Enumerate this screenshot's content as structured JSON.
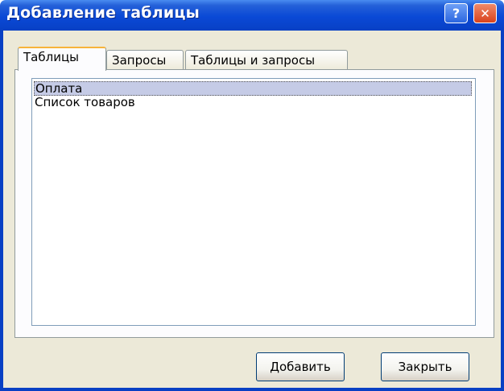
{
  "window": {
    "title": "Добавление таблицы",
    "help_label": "?",
    "close_label": "✕"
  },
  "tabs": [
    {
      "label": "Таблицы",
      "active": true
    },
    {
      "label": "Запросы",
      "active": false
    },
    {
      "label": "Таблицы и запросы",
      "active": false
    }
  ],
  "list": {
    "items": [
      {
        "label": "Оплата",
        "selected": true
      },
      {
        "label": "Список товаров",
        "selected": false
      }
    ]
  },
  "buttons": {
    "add_label": "Добавить",
    "close_label": "Закрыть"
  }
}
